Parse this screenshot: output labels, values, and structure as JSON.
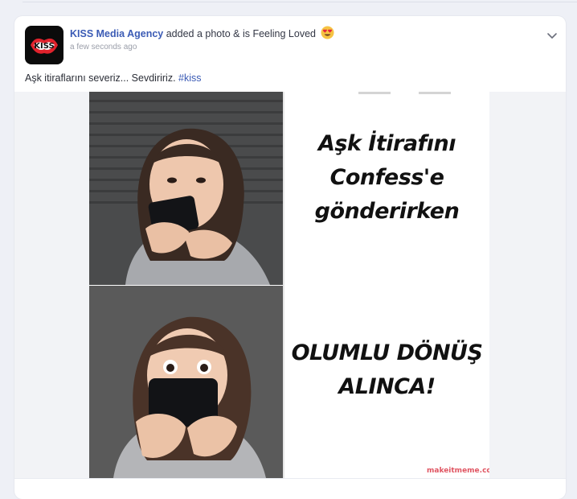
{
  "post": {
    "author": "KISS Media Agency",
    "action": "added a photo & is Feeling Loved",
    "feeling_icon": "heart-eyes-emoji",
    "timestamp": "a few seconds ago",
    "caption": "Aşk itiraflarını severiz... Sevdiririz.",
    "hashtag": "#kiss",
    "avatar_label": "KISS",
    "menu_icon": "chevron-down-icon"
  },
  "meme": {
    "top_text": "Aşk İtirafını Confess'e gönderirken",
    "bottom_text": "OLUMLU DÖNÜŞ ALINCA!",
    "watermark": "makeitmeme.com"
  },
  "colors": {
    "author_link": "#3b5bb5",
    "background": "#eef0f6",
    "card": "#ffffff",
    "brand_red": "#e0222c"
  }
}
